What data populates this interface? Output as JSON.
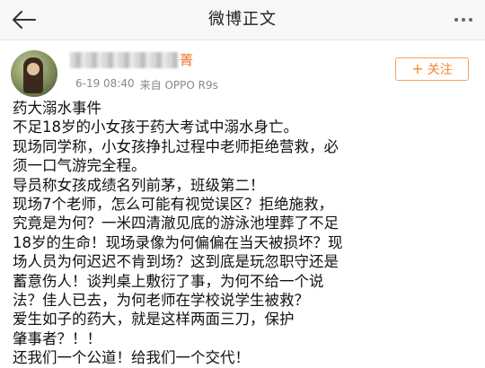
{
  "header": {
    "back_icon": "arrow-left-icon",
    "title": "微博正文",
    "more_icon": "more-dots-icon"
  },
  "author": {
    "name_visible_suffix": "菁",
    "time": "6-19 08:40",
    "source": "来自 OPPO R9s",
    "follow_label": "关注",
    "follow_icon": "plus-icon"
  },
  "post": {
    "lines": [
      "药大溺水事件",
      "不足18岁的小女孩于药大考试中溺水身亡。",
      "现场同学称，小女孩挣扎过程中老师拒绝营救，必",
      "须一口气游完全程。",
      "导员称女孩成绩名列前茅，班级第二！",
      "现场7个老师，怎么可能有视觉误区？拒绝施救，",
      "究竟是为何？一米四清澈见底的游泳池埋葬了不足",
      "18岁的生命！现场录像为何偏偏在当天被损坏？现",
      "场人员为何迟迟不肯到场？这到底是玩忽职守还是",
      "蓄意伤人！谈判桌上敷衍了事，为何不给一个说",
      "法？佳人已去，为何老师在学校说学生被救？",
      "爱生如子的药大，就是这样两面三刀，保护",
      "肇事者？！！",
      "还我们一个公道！给我们一个交代！"
    ]
  }
}
